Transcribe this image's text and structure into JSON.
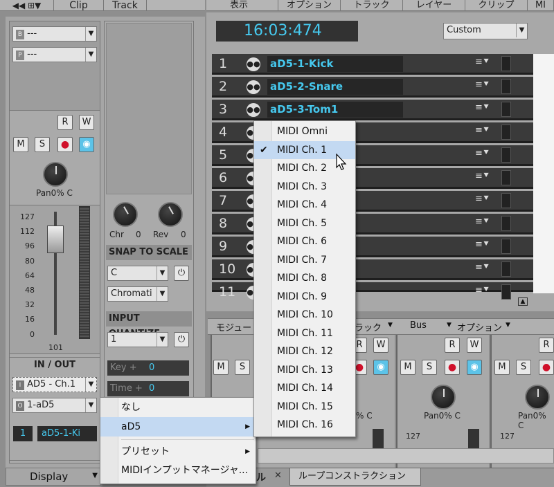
{
  "top_tabs": {
    "nav": "◀◀ ⊞▼",
    "clip": "Clip",
    "track": "Track"
  },
  "track_menu": [
    "表示",
    "オプション",
    "トラック",
    "レイヤー",
    "クリップ",
    "MI"
  ],
  "time": "16:03:474",
  "custom": "Custom",
  "inspector": {
    "b_select": "---",
    "p_select": "---",
    "b_icon": "B",
    "p_icon": "P",
    "r": "R",
    "w": "W",
    "m": "M",
    "s": "S",
    "pan": "Pan0% C",
    "fader_scale": [
      "127",
      "112",
      "96",
      "80",
      "64",
      "48",
      "32",
      "16",
      "0"
    ],
    "fader_value": "101",
    "io_header": "IN / OUT",
    "input_icon": "I",
    "input": "AD5 - Ch.1",
    "output_icon": "O",
    "output": "1-aD5",
    "track_num": "1",
    "track_name": "aD5-1-Ki",
    "display": "Display"
  },
  "fx": {
    "chr": "Chr",
    "chr_val": "0",
    "rev": "Rev",
    "rev_val": "0",
    "snap_title": "SNAP TO SCALE",
    "snap_key": "C",
    "snap_scale": "Chromati",
    "iq_title": "INPUT QUANTIZE",
    "iq_value": "1",
    "key_label": "Key +",
    "key_val": "0",
    "time_label": "Time +",
    "time_val": "0"
  },
  "tracks": [
    {
      "num": "1",
      "name": "aD5-1-Kick"
    },
    {
      "num": "2",
      "name": "aD5-2-Snare"
    },
    {
      "num": "3",
      "name": "aD5-3-Tom1"
    },
    {
      "num": "4",
      "name": ""
    },
    {
      "num": "5",
      "name": ""
    },
    {
      "num": "6",
      "name": ""
    },
    {
      "num": "7",
      "name": ""
    },
    {
      "num": "8",
      "name": ""
    },
    {
      "num": "9",
      "name": ""
    },
    {
      "num": "10",
      "name": ""
    },
    {
      "num": "11",
      "name": ""
    }
  ],
  "console": {
    "module": "モジュー",
    "track": "ラック",
    "bus": "Bus",
    "option": "オプション",
    "pan": "Pan0% C",
    "pan_partial": "% C",
    "scale_top": "127"
  },
  "bottom_tabs": {
    "x": "✕",
    "loop": "ループコンストラクション",
    "left_part": "ル"
  },
  "context_menu": {
    "none": "なし",
    "ad5": "aD5",
    "preset": "プリセット",
    "manager": "MIDIインプットマネージャ..."
  },
  "channel_menu": [
    "MIDI Omni",
    "MIDI Ch. 1",
    "MIDI Ch. 2",
    "MIDI Ch. 3",
    "MIDI Ch. 4",
    "MIDI Ch. 5",
    "MIDI Ch. 6",
    "MIDI Ch. 7",
    "MIDI Ch. 8",
    "MIDI Ch. 9",
    "MIDI Ch. 10",
    "MIDI Ch. 11",
    "MIDI Ch. 12",
    "MIDI Ch. 13",
    "MIDI Ch. 14",
    "MIDI Ch. 15",
    "MIDI Ch. 16"
  ],
  "checkmark": "✔",
  "colors": {
    "accent": "#46c9ef",
    "selected_row": "#c3d9f2",
    "record": "#d0102a"
  }
}
